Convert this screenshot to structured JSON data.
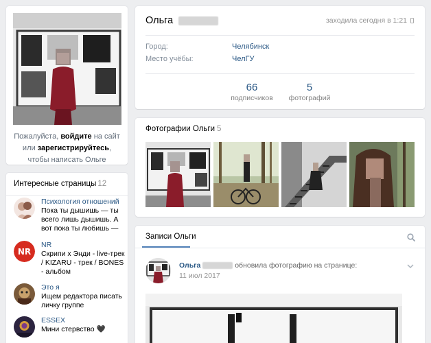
{
  "profile": {
    "first_name": "Ольга",
    "last_seen": "заходила сегодня в 1:21",
    "info": [
      {
        "label": "Город:",
        "value": "Челябинск"
      },
      {
        "label": "Место учёбы:",
        "value": "ЧелГУ"
      }
    ],
    "counters": [
      {
        "value": "66",
        "label": "подписчиков"
      },
      {
        "value": "5",
        "label": "фотографий"
      }
    ]
  },
  "login_note": {
    "part1": "Пожалуйста, ",
    "login": "войдите",
    "part2": " на сайт или ",
    "register": "зарегистрируйтесь",
    "part3": ", чтобы написать Ольге сообщение."
  },
  "pages": {
    "title": "Интересные страницы",
    "count": "12",
    "items": [
      {
        "name": "Психология отношений",
        "desc": "Пока ты дышишь — ты всего лишь дышишь. А вот пока ты любишь —",
        "icon": "couple-avatar",
        "color": "#c9a28f"
      },
      {
        "name": "NR",
        "desc": "Скрипи х Энди - live-трек / KIZARU - трек / BONES - альбом",
        "icon": "nr-logo",
        "color": "#d62b1f"
      },
      {
        "name": "Это я",
        "desc": "Ищем редактора писать личку группе",
        "icon": "cartoon-avatar",
        "color": "#6b4a3a"
      },
      {
        "name": "ESSEX",
        "desc": "Мини стервство 🖤",
        "icon": "essex-avatar",
        "color": "#2c2440"
      }
    ]
  },
  "photos": {
    "title": "Фотографии Ольги",
    "count": "5"
  },
  "wall": {
    "tab_label": "Записи Ольги",
    "post": {
      "author": "Ольга",
      "action": "обновила фотографию на странице:",
      "date": "11 июл 2017"
    }
  }
}
